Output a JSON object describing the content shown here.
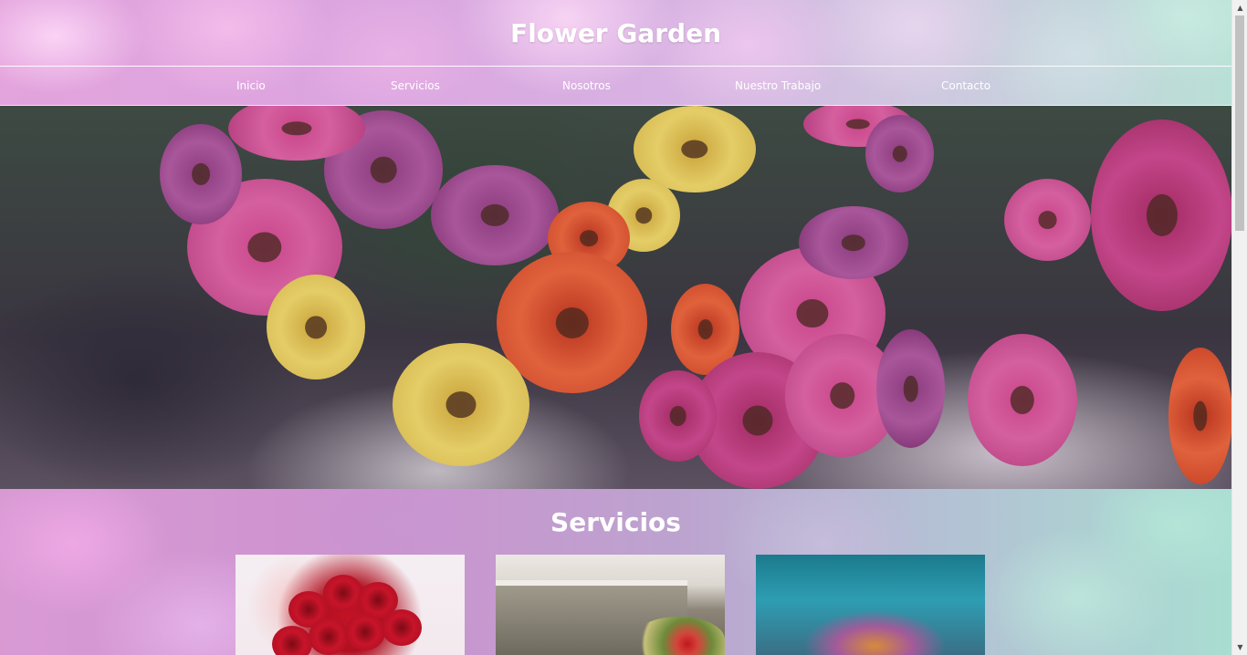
{
  "site": {
    "title": "Flower Garden"
  },
  "nav": {
    "items": [
      {
        "label": "Inicio"
      },
      {
        "label": "Servicios"
      },
      {
        "label": "Nosotros"
      },
      {
        "label": "Nuestro Trabajo"
      },
      {
        "label": "Contacto"
      }
    ]
  },
  "hero": {
    "icon": "flowers-image"
  },
  "services": {
    "title": "Servicios",
    "cards": [
      {
        "icon": "red-roses-bouquet-image"
      },
      {
        "icon": "flower-arrangement-doorway-image"
      },
      {
        "icon": "flower-stand-image"
      }
    ]
  },
  "scrollbar": {
    "up_icon": "▲",
    "down_icon": "▼"
  },
  "colors": {
    "text": "#ffffff",
    "nav_border": "#ffffff",
    "scrollbar_track": "#f1f1f1",
    "scrollbar_thumb": "#c1c1c1"
  }
}
